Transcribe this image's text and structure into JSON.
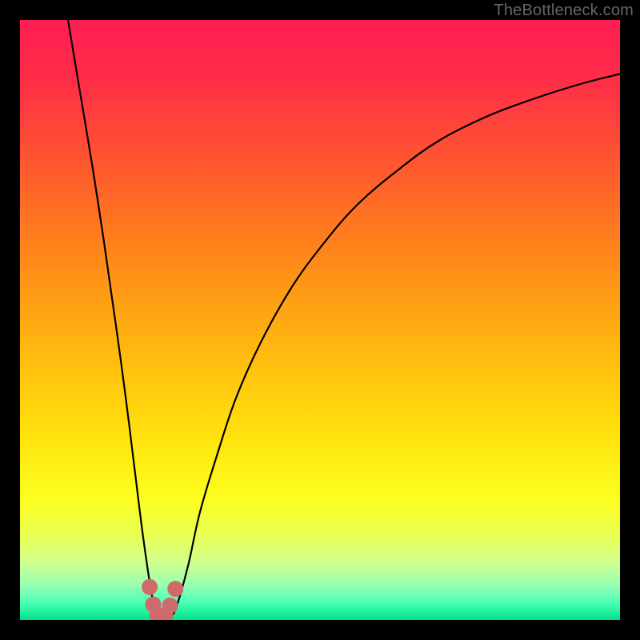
{
  "watermark": "TheBottleneck.com",
  "chart_data": {
    "type": "line",
    "title": "",
    "xlabel": "",
    "ylabel": "",
    "xlim": [
      0,
      100
    ],
    "ylim": [
      0,
      100
    ],
    "background_gradient_stops": [
      {
        "pos": 0.0,
        "color": "#ff1e55"
      },
      {
        "pos": 0.1,
        "color": "#ff2e47"
      },
      {
        "pos": 0.25,
        "color": "#ff5a2d"
      },
      {
        "pos": 0.4,
        "color": "#ff8a1a"
      },
      {
        "pos": 0.55,
        "color": "#ffb80f"
      },
      {
        "pos": 0.7,
        "color": "#ffe40c"
      },
      {
        "pos": 0.8,
        "color": "#fbff20"
      },
      {
        "pos": 0.86,
        "color": "#eaff55"
      },
      {
        "pos": 0.9,
        "color": "#d4ff8a"
      },
      {
        "pos": 0.94,
        "color": "#9bffb0"
      },
      {
        "pos": 0.97,
        "color": "#4dffb8"
      },
      {
        "pos": 1.0,
        "color": "#00e38a"
      }
    ],
    "series": [
      {
        "name": "bottleneck-curve",
        "x": [
          8,
          10,
          12,
          14,
          16,
          17.5,
          19,
          20.5,
          22,
          23,
          24,
          25,
          26,
          28,
          30,
          33,
          36,
          40,
          45,
          50,
          56,
          63,
          70,
          78,
          86,
          94,
          100
        ],
        "y": [
          100,
          88,
          76,
          63,
          49,
          38,
          26,
          14,
          4,
          0.5,
          0.5,
          0.7,
          2,
          9,
          18,
          28,
          37,
          46,
          55,
          62,
          69,
          75,
          80,
          84,
          87,
          89.5,
          91
        ]
      }
    ],
    "markers": [
      {
        "x": 21.6,
        "y": 5.5,
        "color": "#cf6a6a",
        "r": 10
      },
      {
        "x": 22.2,
        "y": 2.6,
        "color": "#cf6a6a",
        "r": 10
      },
      {
        "x": 22.9,
        "y": 0.8,
        "color": "#cf6a6a",
        "r": 10
      },
      {
        "x": 24.2,
        "y": 0.8,
        "color": "#cf6a6a",
        "r": 10
      },
      {
        "x": 25.0,
        "y": 2.4,
        "color": "#cf6a6a",
        "r": 10
      },
      {
        "x": 25.9,
        "y": 5.2,
        "color": "#cf6a6a",
        "r": 10
      }
    ],
    "notes": "V-shaped bottleneck curve. y represents bottleneck percentage (top=100%, bottom=0%). Background gradient runs red→yellow→green top→bottom. Optimal (zero-bottleneck) point is near x≈23–24. Axis ticks and numeric labels are not shown in the image; values are estimated from curve geometry on a 0–100 normalized domain."
  }
}
